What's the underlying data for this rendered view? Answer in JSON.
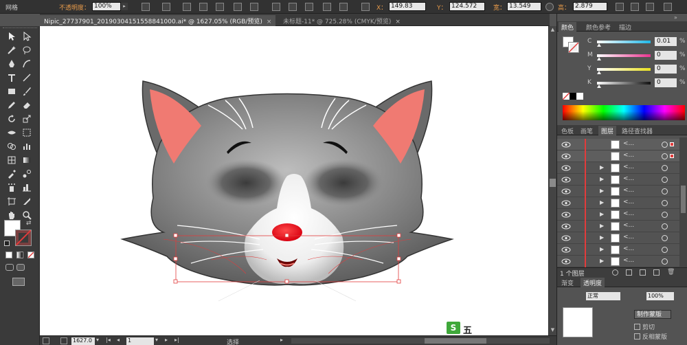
{
  "control_bar": {
    "left_label": "网格",
    "opacity_label": "不透明度：",
    "opacity_value": "100%",
    "x_label": "X：",
    "x_value": "149.83",
    "y_label": "Y：",
    "y_value": "124.572",
    "w_label": "宽：",
    "w_value": "13.549",
    "h_label": "高：",
    "h_value": "2.879"
  },
  "tabs": [
    {
      "label": "Nipic_27737901_20190304151558841000.ai* @ 1627.05% (RGB/预览)",
      "close": "×"
    },
    {
      "label": "未标题-11* @ 725.28% (CMYK/预览)",
      "close": "×"
    }
  ],
  "status_bar": {
    "zoom_value": "1627.0",
    "artboard_value": "1",
    "status_text": "选择"
  },
  "color_panel": {
    "tabs": [
      "颜色",
      "颜色参考",
      "描边"
    ],
    "sliders": [
      {
        "label": "C",
        "value": "0.01",
        "unit": "%",
        "color": "#1fb8e8"
      },
      {
        "label": "M",
        "value": "0",
        "unit": "%",
        "color": "#e8348f"
      },
      {
        "label": "Y",
        "value": "0",
        "unit": "%",
        "color": "#e8e020"
      },
      {
        "label": "K",
        "value": "0",
        "unit": "%",
        "color": "#111111"
      }
    ]
  },
  "layers_panel": {
    "tabs": [
      "色板",
      "画笔",
      "图层",
      "路径查找器"
    ],
    "rows": [
      {
        "name": "<...",
        "selected": true
      },
      {
        "name": "<...",
        "selected": true
      },
      {
        "name": "<...",
        "selected": false
      },
      {
        "name": "<...",
        "selected": false
      },
      {
        "name": "<...",
        "selected": false
      },
      {
        "name": "<...",
        "selected": false
      },
      {
        "name": "<...",
        "selected": false
      },
      {
        "name": "<...",
        "selected": false
      },
      {
        "name": "<...",
        "selected": false
      },
      {
        "name": "<...",
        "selected": false
      },
      {
        "name": "<...",
        "selected": false
      }
    ],
    "footer_text": "1 个图层"
  },
  "transparency_panel": {
    "tab": "渐变",
    "tab2": "透明度",
    "blend_label": "正常",
    "opacity_value": "100%",
    "make_mask_button": "制作蒙版",
    "clip_label": "剪切",
    "invert_label": "反相蒙版"
  },
  "watermark_text": "五",
  "colors": {
    "accent_red": "#e23b3b",
    "cat_ear_pink": "#f07a72",
    "nose_red": "#e8101a",
    "panel_bg": "#535353"
  }
}
